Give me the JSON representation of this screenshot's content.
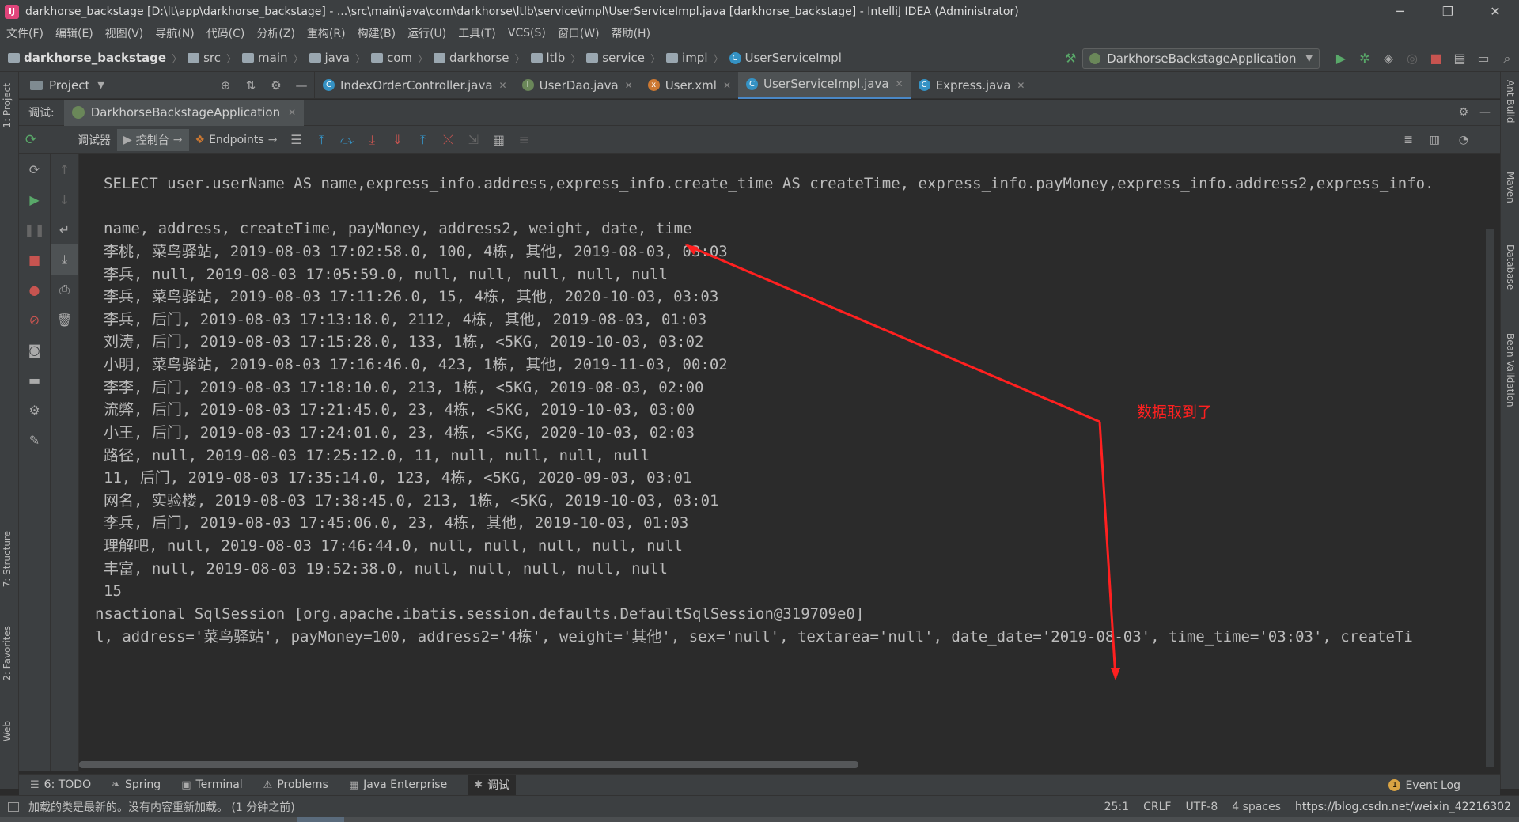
{
  "window": {
    "title": "darkhorse_backstage [D:\\lt\\app\\darkhorse_backstage] - ...\\src\\main\\java\\com\\darkhorse\\ltlb\\service\\impl\\UserServiceImpl.java [darkhorse_backstage] - IntelliJ IDEA (Administrator)",
    "minimize": "─",
    "restore": "❐",
    "close": "✕"
  },
  "menu": [
    "文件(F)",
    "编辑(E)",
    "视图(V)",
    "导航(N)",
    "代码(C)",
    "分析(Z)",
    "重构(R)",
    "构建(B)",
    "运行(U)",
    "工具(T)",
    "VCS(S)",
    "窗口(W)",
    "帮助(H)"
  ],
  "breadcrumb": {
    "project": "darkhorse_backstage",
    "items": [
      "src",
      "main",
      "java",
      "com",
      "darkhorse",
      "ltlb",
      "service",
      "impl"
    ],
    "file": "UserServiceImpl"
  },
  "run_config": "DarkhorseBackstageApplication",
  "project_tool": {
    "label": "Project"
  },
  "editor_tabs": [
    {
      "label": "IndexOrderController.java",
      "icon": "C",
      "color": "#3592c4",
      "active": false
    },
    {
      "label": "UserDao.java",
      "icon": "I",
      "color": "#6a8759",
      "active": false
    },
    {
      "label": "User.xml",
      "icon": "x",
      "color": "#cc7832",
      "active": false
    },
    {
      "label": "UserServiceImpl.java",
      "icon": "C",
      "color": "#3592c4",
      "active": true
    },
    {
      "label": "Express.java",
      "icon": "C",
      "color": "#3592c4",
      "active": false
    }
  ],
  "debug": {
    "label": "调试:",
    "session": "DarkhorseBackstageApplication",
    "subtabs": [
      "调试器",
      "控制台",
      "Endpoints"
    ]
  },
  "console_lines": [
    "SELECT user.userName AS name,express_info.address,express_info.create_time AS createTime, express_info.payMoney,express_info.address2,express_info.",
    "",
    "name, address, createTime, payMoney, address2, weight, date, time",
    "李桃, 菜鸟驿站, 2019-08-03 17:02:58.0, 100, 4栋, 其他, 2019-08-03, 03:03",
    "李兵, null, 2019-08-03 17:05:59.0, null, null, null, null, null",
    "李兵, 菜鸟驿站, 2019-08-03 17:11:26.0, 15, 4栋, 其他, 2020-10-03, 03:03",
    "李兵, 后门, 2019-08-03 17:13:18.0, 2112, 4栋, 其他, 2019-08-03, 01:03",
    "刘涛, 后门, 2019-08-03 17:15:28.0, 133, 1栋, <5KG, 2019-10-03, 03:02",
    "小明, 菜鸟驿站, 2019-08-03 17:16:46.0, 423, 1栋, 其他, 2019-11-03, 00:02",
    "李李, 后门, 2019-08-03 17:18:10.0, 213, 1栋, <5KG, 2019-08-03, 02:00",
    "流弊, 后门, 2019-08-03 17:21:45.0, 23, 4栋, <5KG, 2019-10-03, 03:00",
    "小王, 后门, 2019-08-03 17:24:01.0, 23, 4栋, <5KG, 2020-10-03, 02:03",
    "路径, null, 2019-08-03 17:25:12.0, 11, null, null, null, null",
    "11, 后门, 2019-08-03 17:35:14.0, 123, 4栋, <5KG, 2020-09-03, 03:01",
    "网名, 实验楼, 2019-08-03 17:38:45.0, 213, 1栋, <5KG, 2019-10-03, 03:01",
    "李兵, 后门, 2019-08-03 17:45:06.0, 23, 4栋, 其他, 2019-10-03, 01:03",
    "理解吧, null, 2019-08-03 17:46:44.0, null, null, null, null, null",
    "丰富, null, 2019-08-03 19:52:38.0, null, null, null, null, null",
    "15",
    "nsactional SqlSession [org.apache.ibatis.session.defaults.DefaultSqlSession@319709e0]",
    "l, address='菜鸟驿站', payMoney=100, address2='4栋', weight='其他', sex='null', textarea='null', date_date='2019-08-03', time_time='03:03', createTi"
  ],
  "annotation": {
    "text": "数据取到了",
    "color": "#ff2020"
  },
  "left_strip": {
    "project": "1: Project",
    "structure": "7: Structure",
    "favorites": "2: Favorites",
    "web": "Web"
  },
  "right_strip": {
    "ant": "Ant Build",
    "maven": "Maven",
    "database": "Database",
    "bean": "Bean Validation"
  },
  "bottom_tabs": [
    {
      "label": "6: TODO",
      "icon": "☰"
    },
    {
      "label": "Spring",
      "icon": "❧"
    },
    {
      "label": "Terminal",
      "icon": "▣"
    },
    {
      "label": "Problems",
      "icon": "⚠"
    },
    {
      "label": "Java Enterprise",
      "icon": "▦"
    },
    {
      "label": "调试",
      "icon": "✱",
      "active": true
    }
  ],
  "event_log": {
    "label": "Event Log",
    "count": "1"
  },
  "status": {
    "message": "加载的类是最新的。没有内容重新加载。 (1 分钟之前)",
    "position": "25:1",
    "line_sep": "CRLF",
    "encoding": "UTF-8",
    "indent": "4 spaces",
    "watermark": "https://blog.csdn.net/weixin_42216302"
  }
}
